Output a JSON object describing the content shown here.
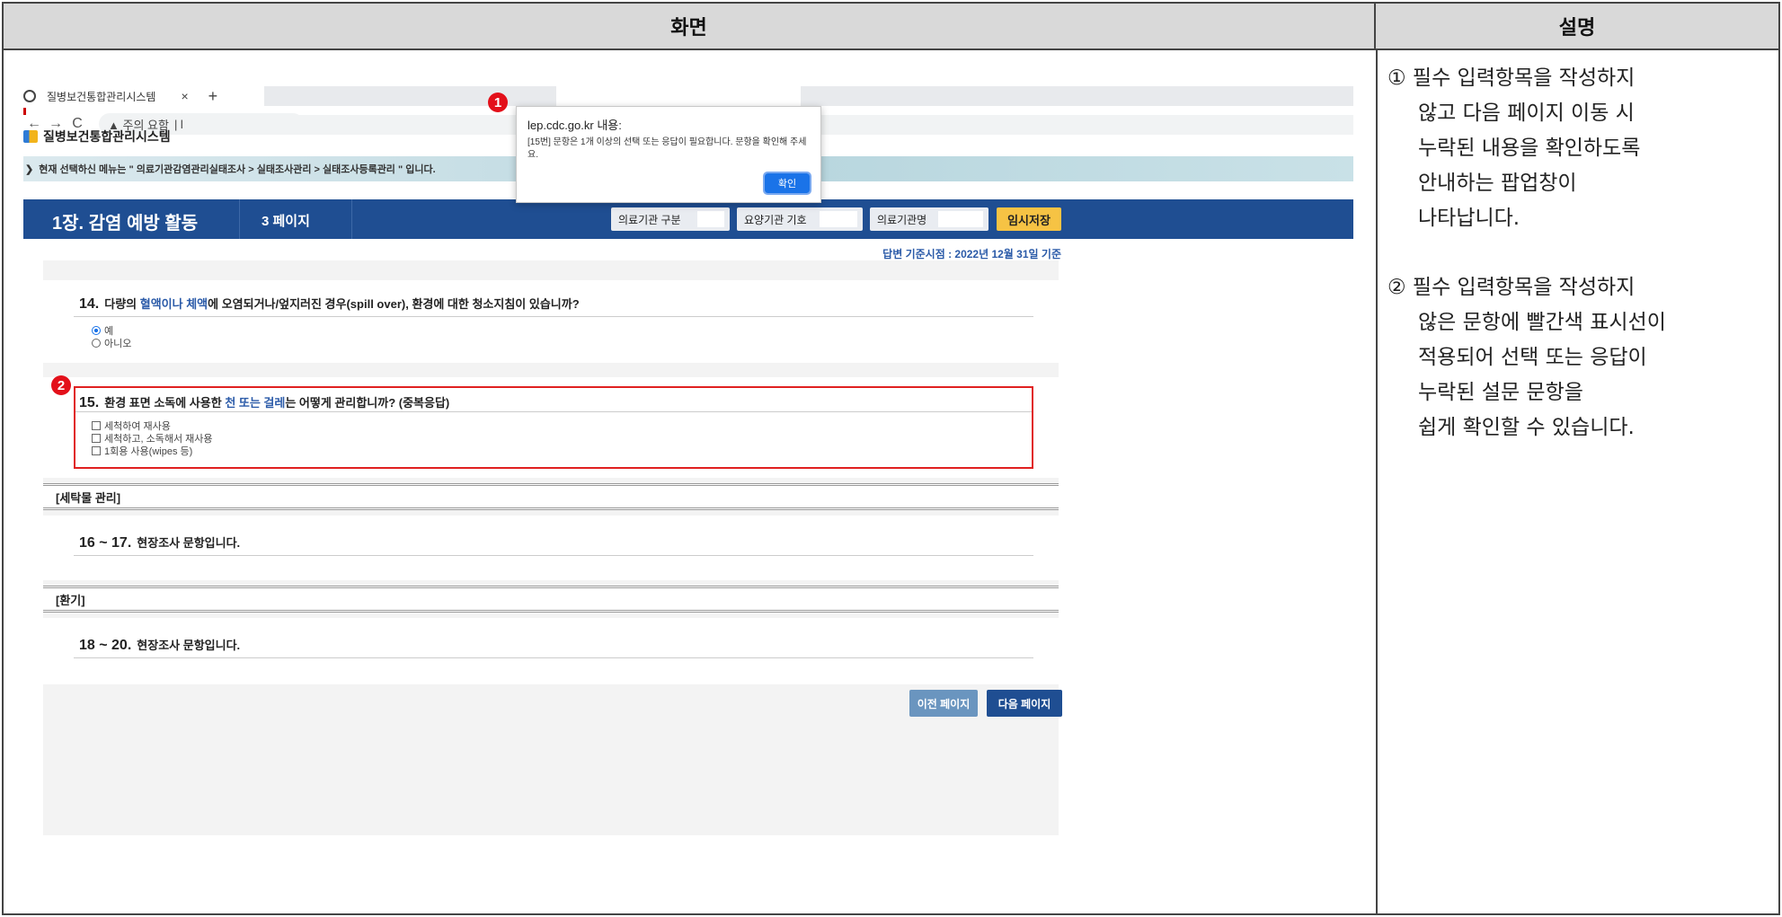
{
  "header": {
    "left": "화면",
    "right": "설명"
  },
  "browser": {
    "tab_title": "질병보건통합관리시스템",
    "tab_close": "×",
    "tab_new": "+",
    "back": "←",
    "forward": "→",
    "reload": "C",
    "url_warning": "▲ 주의 요함",
    "url_text": "|  l"
  },
  "site": {
    "logo_text": "질병보건통합관리시스템",
    "menu_path": "현재 선택하신 메뉴는 \" 의료기관감염관리실태조사 > 실태조사관리 > 실태조사등록관리 \" 입니다."
  },
  "dialog": {
    "title": "lep.cdc.go.kr 내용:",
    "message": "[15번] 문항은 1개 이상의 선택 또는 응답이 필요합니다. 문항을 확인해 주세요.",
    "ok": "확인"
  },
  "survey_bar": {
    "chapter": "1장. 감염 예방 활동",
    "page": "3 페이지",
    "field1": "의료기관 구분",
    "field2": "요양기관 기호",
    "field3": "의료기관명",
    "save": "임시저장"
  },
  "basis_date": "답변 기준시점 : 2022년 12월 31일 기준",
  "q14": {
    "num": "14.",
    "pre": "다량의 ",
    "hl": "혈액이나 체액",
    "post": "에 오염되거나/엎지러진 경우(spill over), 환경에 대한 청소지침이 있습니까?",
    "options": [
      "예",
      "아니오"
    ],
    "selected": "예"
  },
  "q15": {
    "num": "15.",
    "pre": "환경 표면 소독에 사용한 ",
    "hl": "천 또는 걸레",
    "post": "는 어떻게 관리합니까? (중복응답)",
    "options": [
      "세척하여 재사용",
      "세척하고, 소독해서 재사용",
      "1회용 사용(wipes 등)"
    ]
  },
  "section_laundry": "[세탁물 관리]",
  "q16": {
    "num": "16 ~ 17.",
    "text": "현장조사 문항입니다."
  },
  "section_vent": "[환기]",
  "q18": {
    "num": "18 ~ 20.",
    "text": "현장조사 문항입니다."
  },
  "nav": {
    "prev": "이전 페이지",
    "next": "다음 페이지"
  },
  "badges": {
    "one": "1",
    "two": "2"
  },
  "desc": {
    "item1": [
      "① 필수 입력항목을 작성하지",
      "않고 다음 페이지 이동 시",
      "누락된 내용을 확인하도록",
      "안내하는 팝업창이",
      "나타납니다."
    ],
    "item2": [
      "② 필수 입력항목을 작성하지",
      "않은 문항에 빨간색 표시선이",
      "적용되어 선택 또는 응답이",
      "누락된 설문 문항을",
      "쉽게 확인할 수 있습니다."
    ]
  }
}
